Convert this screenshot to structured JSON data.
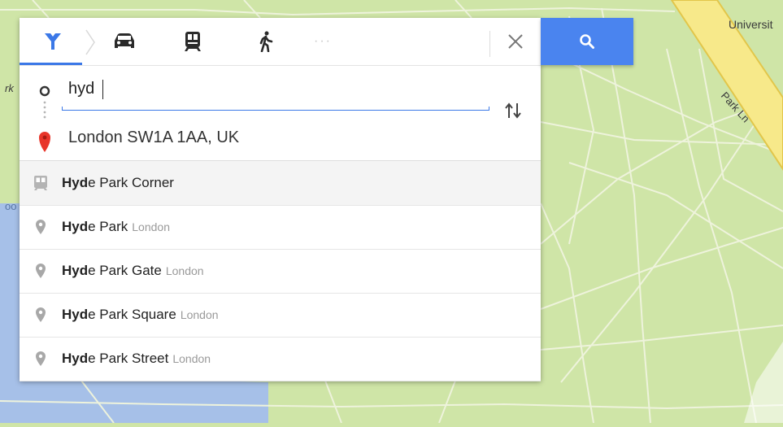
{
  "map": {
    "labels": [
      "Universit",
      "Park Ln",
      "rk",
      "oo"
    ],
    "colors": {
      "park": "#cfe5a7",
      "path": "#eef3dc",
      "road": "#f7e98a",
      "road_edge": "#e2c64a",
      "water": "#a6c0e8"
    }
  },
  "directions": {
    "modes": [
      {
        "name": "best-route",
        "active": true
      },
      {
        "name": "car",
        "active": false
      },
      {
        "name": "transit",
        "active": false
      },
      {
        "name": "walking",
        "active": false
      },
      {
        "name": "more",
        "active": false
      }
    ],
    "more_label": "···",
    "origin_value": "hyd",
    "destination_value": "London SW1A 1AA, UK",
    "accent": "#4a84ef"
  },
  "suggestions": [
    {
      "bold": "Hyd",
      "rest": "e Park Corner",
      "secondary": "",
      "icon": "transit-station-icon"
    },
    {
      "bold": "Hyd",
      "rest": "e Park",
      "secondary": "London",
      "icon": "place-pin-icon"
    },
    {
      "bold": "Hyd",
      "rest": "e Park Gate",
      "secondary": "London",
      "icon": "place-pin-icon"
    },
    {
      "bold": "Hyd",
      "rest": "e Park Square",
      "secondary": "London",
      "icon": "place-pin-icon"
    },
    {
      "bold": "Hyd",
      "rest": "e Park Street",
      "secondary": "London",
      "icon": "place-pin-icon"
    }
  ]
}
